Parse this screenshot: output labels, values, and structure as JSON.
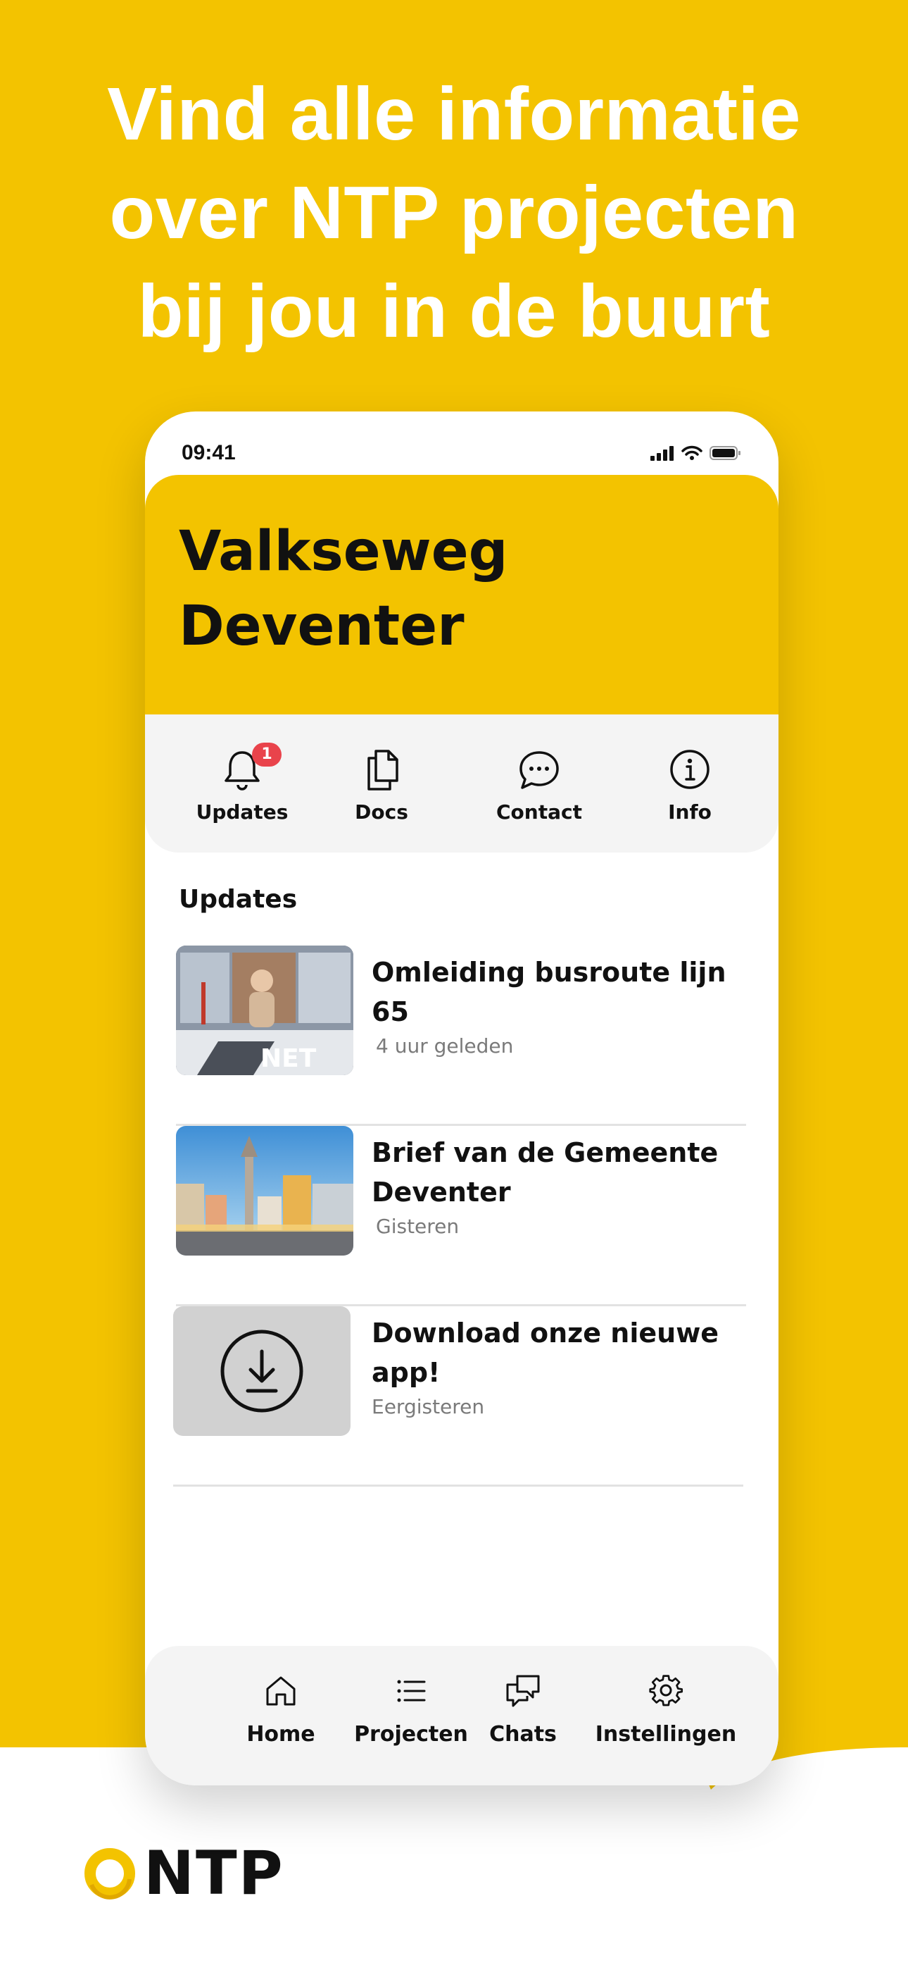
{
  "promo": {
    "headline": [
      "Vind alle informatie",
      "over NTP projecten",
      "bij jou in de buurt"
    ],
    "logo_text": "NTP"
  },
  "status_bar": {
    "time": "09:41"
  },
  "project": {
    "title_line1": "Valkseweg",
    "title_line2": "Deventer"
  },
  "quick_nav": {
    "items": [
      {
        "label": "Updates",
        "icon": "bell-icon",
        "badge": "1"
      },
      {
        "label": "Docs",
        "icon": "documents-icon"
      },
      {
        "label": "Contact",
        "icon": "chat-bubble-icon"
      },
      {
        "label": "Info",
        "icon": "info-icon"
      }
    ]
  },
  "updates": {
    "title": "Updates",
    "items": [
      {
        "title": "Omleiding busroute lijn 65",
        "time": "4 uur geleden",
        "thumb": "bus-photo"
      },
      {
        "title": "Brief van de Gemeente Deventer",
        "time": "Gisteren",
        "thumb": "town-square-photo"
      },
      {
        "title": "Download onze nieuwe app!",
        "time": "Eergisteren",
        "thumb": "download-icon"
      }
    ]
  },
  "tab_bar": {
    "items": [
      {
        "label": "Home",
        "icon": "home-icon"
      },
      {
        "label": "Projecten",
        "icon": "list-icon"
      },
      {
        "label": "Chats",
        "icon": "chats-icon"
      },
      {
        "label": "Instellingen",
        "icon": "gear-icon"
      }
    ]
  },
  "colors": {
    "brand_yellow": "#F3C300",
    "badge_red": "#E9434B",
    "panel_gray": "#F4F4F4"
  }
}
